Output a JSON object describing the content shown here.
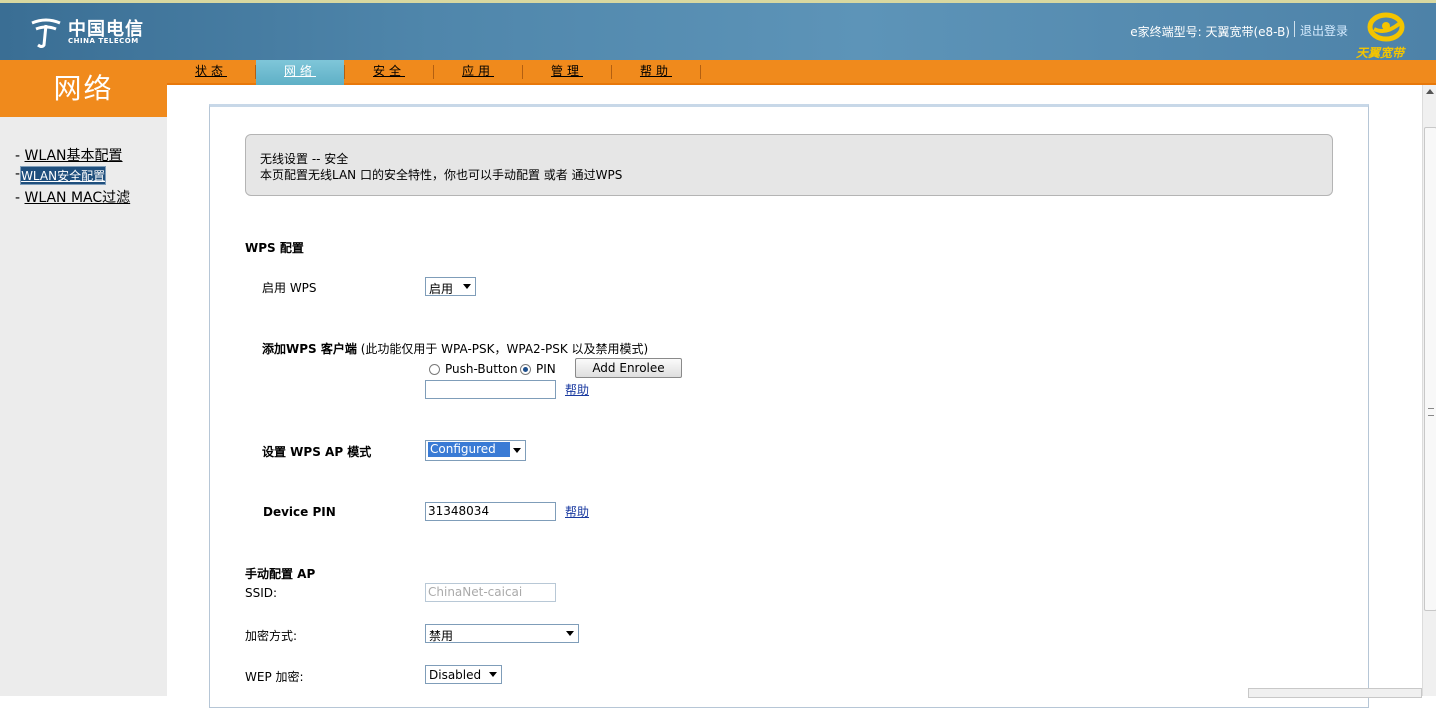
{
  "header": {
    "logo_cn": "中国电信",
    "logo_en": "CHINA TELECOM",
    "model_label": "e家终端型号: 天翼宽带(e8-B)",
    "logout": "退出登录",
    "brand": "天翼宽带"
  },
  "section_title": "网络",
  "nav": {
    "tabs": [
      "状态",
      "网络",
      "安全",
      "应用",
      "管理",
      "帮助"
    ],
    "active": "网络"
  },
  "sidebar": {
    "items": [
      "WLAN基本配置",
      "WLAN安全配置",
      "WLAN MAC过滤"
    ],
    "selected": "WLAN安全配置"
  },
  "info": {
    "line1": "无线设置  -- 安全",
    "line2": "本页配置无线LAN 口的安全特性，你也可以手动配置  或者  通过WPS"
  },
  "wps": {
    "heading": "WPS 配置",
    "enable_label": "启用  WPS",
    "enable_value": "启用",
    "add_client_label": "添加WPS 客户端",
    "add_client_note": "(此功能仅用于  WPA-PSK，WPA2-PSK 以及禁用模式)",
    "radio_push": "Push-Button",
    "radio_pin": "PIN",
    "radio_selected": "PIN",
    "add_enrolee": "Add Enrolee",
    "pin_input": "",
    "help": "帮助",
    "ap_mode_label": "设置  WPS AP 模式",
    "ap_mode_value": "Configured",
    "device_pin_label": "Device PIN",
    "device_pin_value": "31348034"
  },
  "manual": {
    "heading": "手动配置  AP",
    "ssid_label": "SSID:",
    "ssid_value": "ChinaNet-caicai",
    "encryption_label": "加密方式:",
    "encryption_value": "禁用",
    "wep_label": "WEP 加密:",
    "wep_value": "Disabled"
  },
  "colors": {
    "header_blue": "#4f86ab",
    "nav_orange": "#f08a1c",
    "tab_active": "#6db8cd",
    "link_blue": "#1a3aa0"
  }
}
